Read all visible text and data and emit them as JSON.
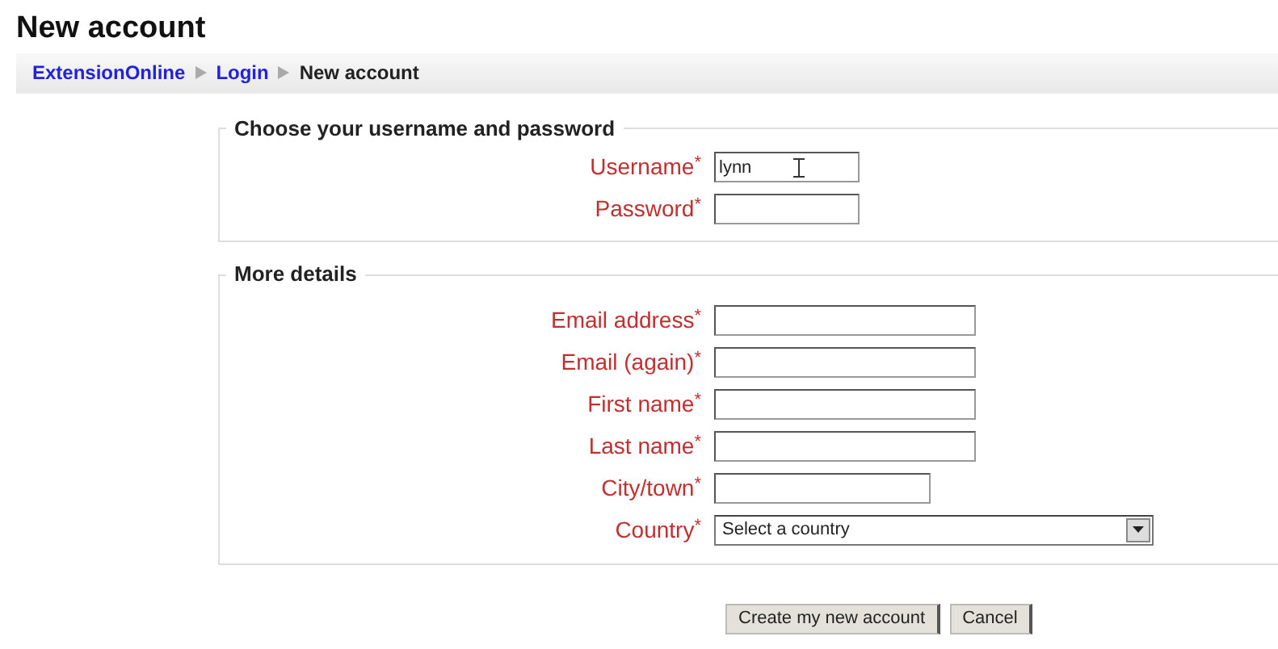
{
  "title": "New account",
  "breadcrumb": [
    {
      "label": "ExtensionOnline",
      "kind": "link"
    },
    {
      "label": "Login",
      "kind": "link"
    },
    {
      "label": "New account",
      "kind": "current"
    }
  ],
  "sections": [
    {
      "legend": "Choose your username and password",
      "fields": [
        {
          "label": "Username",
          "marker": "*",
          "kind": "text",
          "value": "lynn"
        },
        {
          "label": "Password",
          "marker": "*",
          "kind": "password"
        }
      ]
    },
    {
      "legend": "More details",
      "fields": [
        {
          "label": "Email address",
          "marker": "*",
          "kind": "text"
        },
        {
          "label": "Email (again)",
          "marker": "*",
          "kind": "text"
        },
        {
          "label": "First name",
          "marker": "*",
          "kind": "text"
        },
        {
          "label": "Last name",
          "marker": "*",
          "kind": "text"
        },
        {
          "label": "City/town",
          "marker": "*",
          "kind": "text"
        },
        {
          "label": "Country",
          "marker": "*",
          "kind": "select",
          "value": "Select a country"
        }
      ]
    }
  ],
  "buttons": [
    "Create my new account",
    "Cancel"
  ]
}
